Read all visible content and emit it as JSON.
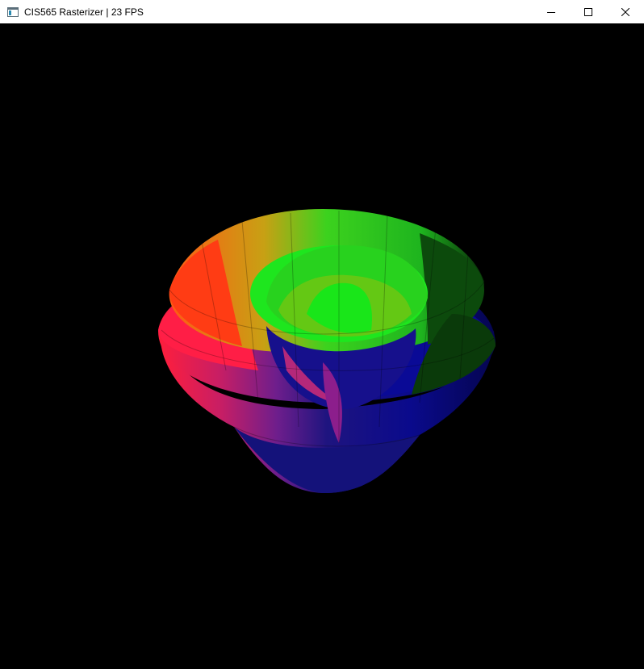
{
  "window": {
    "title": "CIS565 Rasterizer | 23 FPS",
    "icon": "app-window-icon",
    "controls": {
      "minimize": "minimize-icon",
      "maximize": "maximize-icon",
      "close": "close-icon"
    }
  },
  "viewport": {
    "background": "#000000",
    "object_colors": {
      "red": "#ff1e3c",
      "orange": "#ff5a14",
      "yellow_green": "#a0c814",
      "green": "#1ee61e",
      "dark_green": "#0a460a",
      "blue": "#0a0a8c",
      "purple": "#6e1e8c",
      "magenta": "#b41e78"
    }
  }
}
